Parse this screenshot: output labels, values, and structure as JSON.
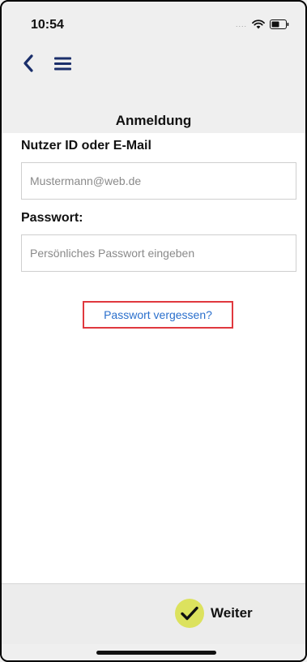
{
  "status_bar": {
    "time": "10:54",
    "signal_dots": "....",
    "icons": [
      "wifi-icon",
      "battery-icon"
    ]
  },
  "nav": {
    "back_icon": "chevron-left-icon",
    "menu_icon": "hamburger-menu-icon",
    "icon_color": "#1b2f6b"
  },
  "page": {
    "title": "Anmeldung"
  },
  "form": {
    "user_label": "Nutzer ID oder E-Mail",
    "user_placeholder": "Mustermann@web.de",
    "password_label": "Passwort:",
    "password_placeholder": "Persönliches Passwort eingeben",
    "forgot_link": "Passwort vergessen?",
    "highlight_color": "#e0383e",
    "link_color": "#2a6fcc"
  },
  "footer": {
    "continue_label": "Weiter",
    "continue_icon": "checkmark-icon",
    "accent_color": "#dce25e"
  }
}
